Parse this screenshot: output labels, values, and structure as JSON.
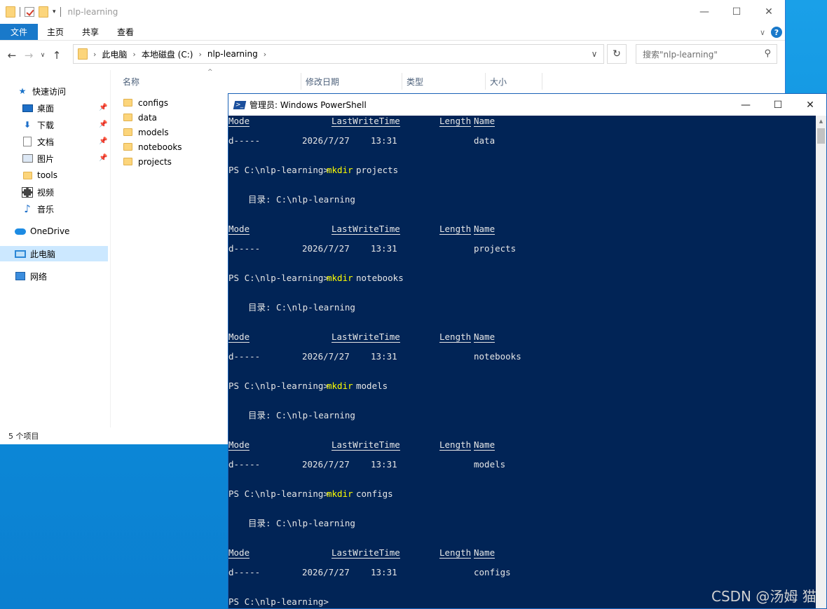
{
  "explorer": {
    "title": "nlp-learning",
    "ribbon_tabs": [
      "文件",
      "主页",
      "共享",
      "查看"
    ],
    "breadcrumb": [
      "此电脑",
      "本地磁盘 (C:)",
      "nlp-learning"
    ],
    "search_placeholder": "搜索\"nlp-learning\"",
    "nav": {
      "quick_access": "快速访问",
      "pinned": [
        "桌面",
        "下载",
        "文档",
        "图片"
      ],
      "others": [
        "tools",
        "视频",
        "音乐"
      ],
      "onedrive": "OneDrive",
      "this_pc": "此电脑",
      "network": "网络"
    },
    "columns": [
      "名称",
      "修改日期",
      "类型",
      "大小"
    ],
    "files": [
      "configs",
      "data",
      "models",
      "notebooks",
      "projects"
    ],
    "status": "5 个项目"
  },
  "powershell": {
    "title": "管理员: Windows PowerShell",
    "prompt": "PS C:\\nlp-learning>",
    "dir_label": "目录: C:\\nlp-learning",
    "headers": {
      "mode": "Mode",
      "lwt": "LastWriteTime",
      "length": "Length",
      "name": "Name"
    },
    "row": {
      "mode": "d-----",
      "date": "2026/7/27",
      "time": "13:31"
    },
    "first_entry": "data",
    "blocks": [
      {
        "cmd": "mkdir",
        "arg": "projects"
      },
      {
        "cmd": "mkdir",
        "arg": "notebooks"
      },
      {
        "cmd": "mkdir",
        "arg": "models"
      },
      {
        "cmd": "mkdir",
        "arg": "configs"
      }
    ]
  },
  "watermark": "CSDN @汤姆 猫"
}
